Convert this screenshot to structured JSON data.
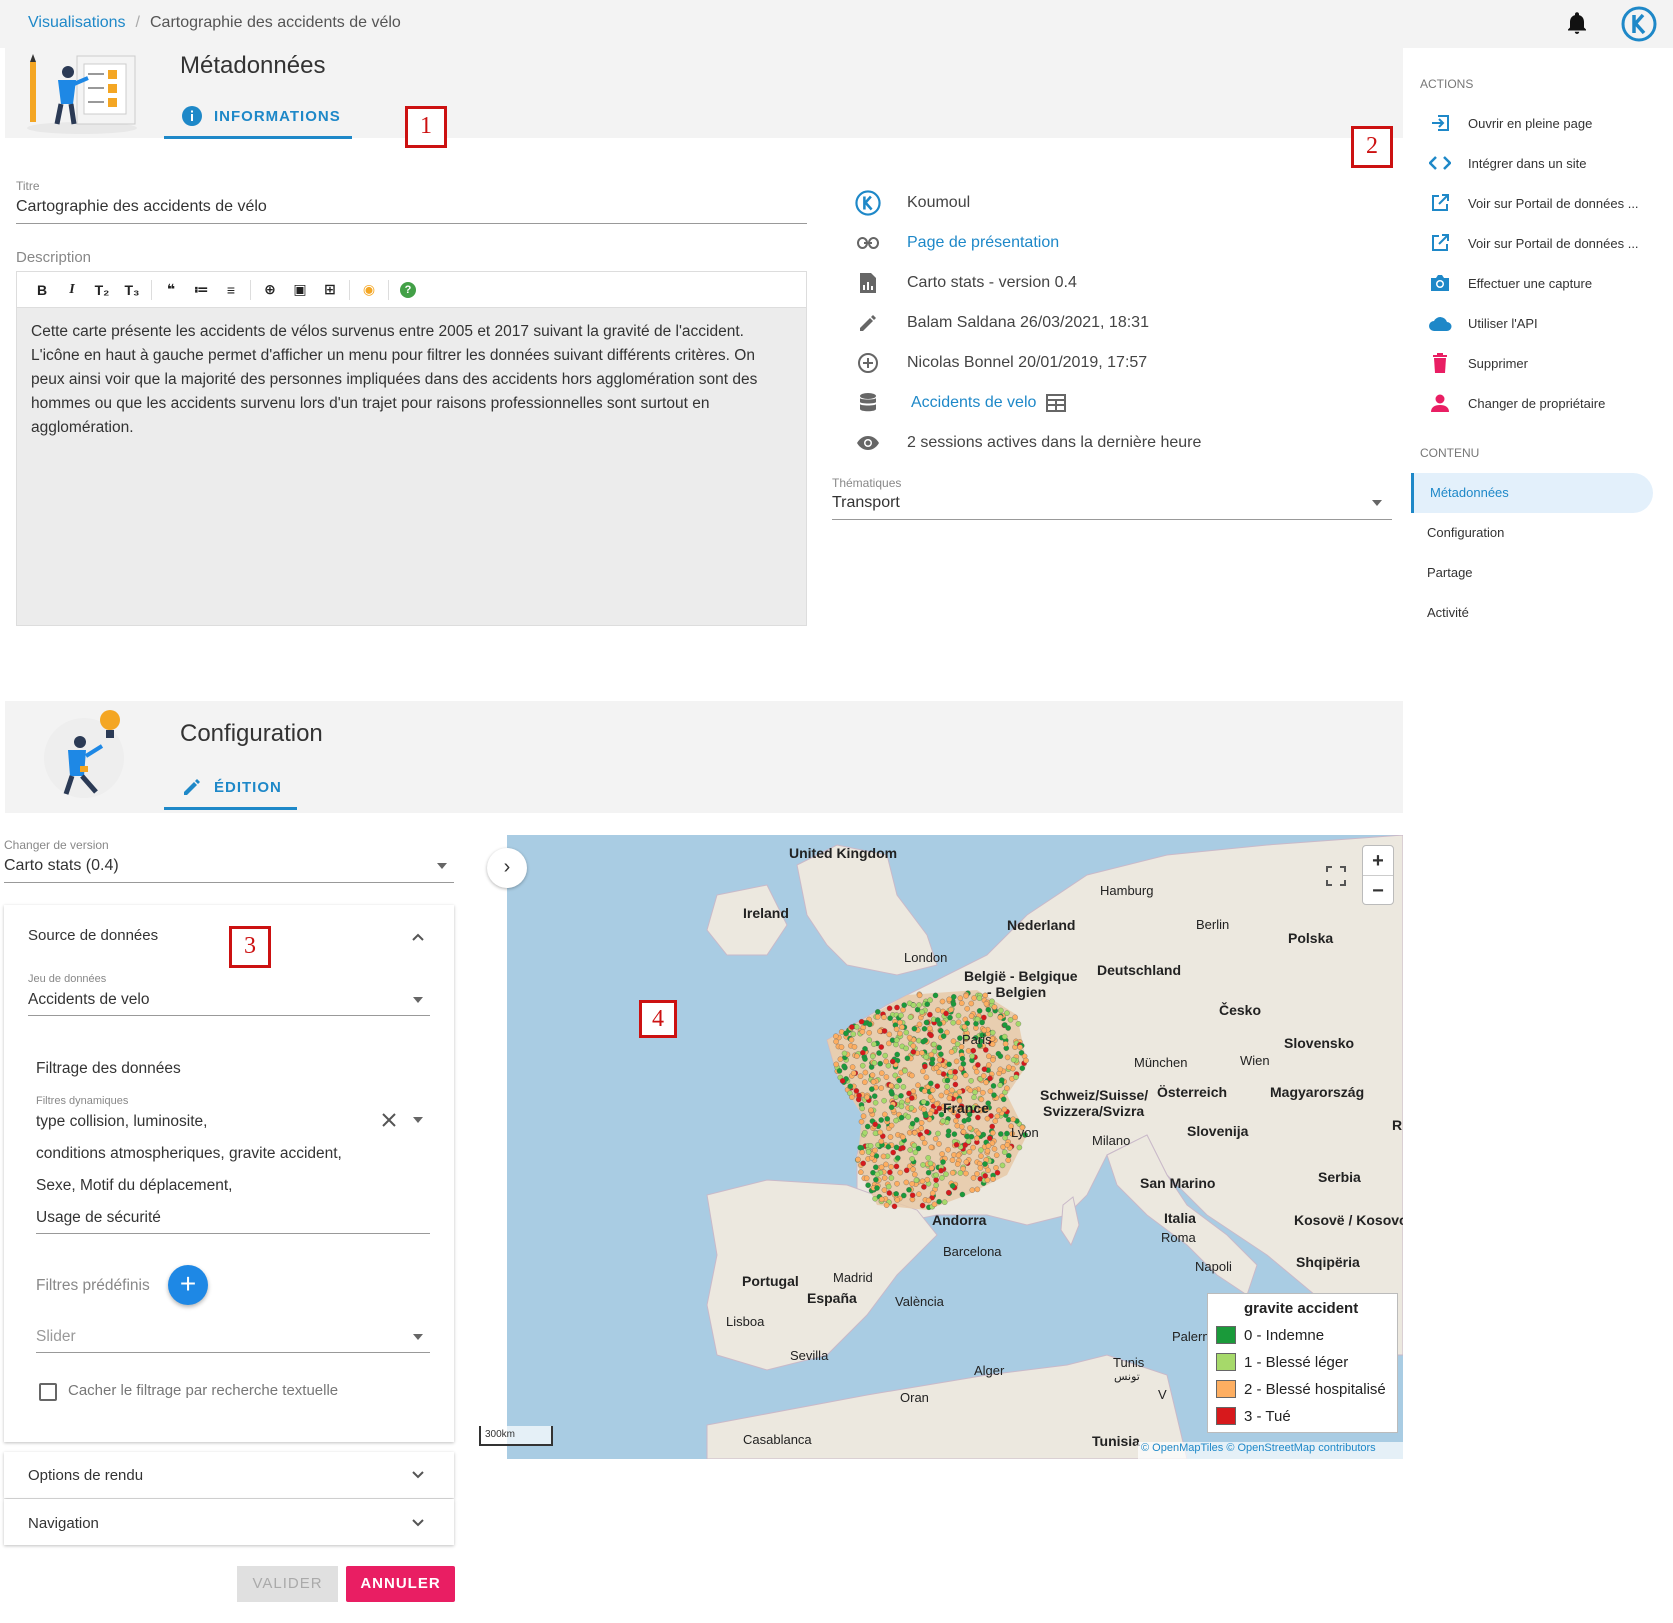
{
  "breadcrumb": {
    "root": "Visualisations",
    "current": "Cartographie des accidents de vélo"
  },
  "annotations": [
    "1",
    "2",
    "3",
    "4"
  ],
  "metadata": {
    "title": "Métadonnées",
    "tab_label": "INFORMATIONS",
    "title_field_label": "Titre",
    "title_field_value": "Cartographie des accidents de vélo",
    "description_label": "Description",
    "toolbar": [
      "B",
      "I",
      "T₂",
      "T₃",
      "❝",
      "≔",
      "≡",
      "⊕",
      "▣",
      "⊞",
      "◉",
      "?"
    ],
    "description_lines": [
      "Cette carte présente les accidents de vélos survenus entre 2005 et 2017 suivant la gravité de l'accident.",
      "L'icône en haut à gauche permet d'afficher un menu pour filtrer les données suivant différents critères. On",
      "peux ainsi voir que la majorité des personnes impliquées dans des accidents hors agglomération sont des",
      "hommes ou que les accidents survenu lors d'un trajet pour raisons professionnelles sont surtout en",
      "agglomération."
    ],
    "info": {
      "owner": "Koumoul",
      "presentation_link": "Page de présentation",
      "version": "Carto stats - version 0.4",
      "updated": "Balam Saldana 26/03/2021, 18:31",
      "created": "Nicolas Bonnel 20/01/2019, 17:57",
      "dataset": "Accidents de velo",
      "sessions": "2 sessions actives dans la dernière heure"
    },
    "thematiques_label": "Thématiques",
    "thematiques_value": "Transport"
  },
  "sidebar": {
    "actions_heading": "ACTIONS",
    "actions": [
      {
        "label": "Ouvrir en pleine page",
        "icon": "fullpage-icon"
      },
      {
        "label": "Intégrer dans un site",
        "icon": "code-icon"
      },
      {
        "label": "Voir sur Portail de données ...",
        "icon": "external-link-icon"
      },
      {
        "label": "Voir sur Portail de données ...",
        "icon": "external-link-icon"
      },
      {
        "label": "Effectuer une capture",
        "icon": "camera-icon"
      },
      {
        "label": "Utiliser l'API",
        "icon": "cloud-icon"
      },
      {
        "label": "Supprimer",
        "icon": "trash-icon"
      },
      {
        "label": "Changer de propriétaire",
        "icon": "person-icon"
      }
    ],
    "content_heading": "CONTENU",
    "content": [
      "Métadonnées",
      "Configuration",
      "Partage",
      "Activité"
    ]
  },
  "configuration": {
    "title": "Configuration",
    "tab_label": "ÉDITION",
    "version_label": "Changer de version",
    "version_value": "Carto stats (0.4)",
    "source_panel_title": "Source de données",
    "dataset_label": "Jeu de données",
    "dataset_value": "Accidents de velo",
    "filter_heading": "Filtrage des données",
    "dynamic_filters_label": "Filtres dynamiques",
    "dynamic_filters_lines": [
      "type collision,  luminosite,",
      "conditions atmospheriques,  gravite accident,",
      "Sexe,  Motif du déplacement,",
      "Usage de sécurité"
    ],
    "predefined_filters_label": "Filtres prédéfinis",
    "slider_placeholder": "Slider",
    "hide_text_filter_label": "Cacher le filtrage par recherche textuelle",
    "render_options_title": "Options de rendu",
    "navigation_title": "Navigation",
    "validate_label": "VALIDER",
    "cancel_label": "ANNULER"
  },
  "map": {
    "labels": {
      "uk": "United Kingdom",
      "ireland": "Ireland",
      "hamburg": "Hamburg",
      "nederland": "Nederland",
      "berlin": "Berlin",
      "polska": "Polska",
      "london": "London",
      "belgie": "België - Belgique",
      "belgien": "- Belgien",
      "deutschland": "Deutschland",
      "cesko": "Česko",
      "paris": "Paris",
      "slovensko": "Slovensko",
      "munchen": "München",
      "wien": "Wien",
      "schweiz": "Schweiz/Suisse/",
      "svizzera": "Svizzera/Svizra",
      "osterreich": "Österreich",
      "magyar": "Magyarország",
      "france": "France",
      "slovenija": "Slovenija",
      "lyon": "Lyon",
      "milano": "Milano",
      "sanmarino": "San Marino",
      "serbia": "Serbia",
      "andorra": "Andorra",
      "italia": "Italia",
      "kosove": "Kosovë / Kosovo",
      "roma": "Roma",
      "barcelona": "Barcelona",
      "napoli": "Napoli",
      "shqiperia": "Shqipëria",
      "portugal": "Portugal",
      "madrid": "Madrid",
      "espana": "España",
      "valencia": "València",
      "lisboa": "Lisboa",
      "sevilla": "Sevilla",
      "alger": "Alger",
      "tunis": "Tunis",
      "tunis_ar": "تونس",
      "palerm": "Palerm",
      "oran": "Oran",
      "casablanca": "Casablanca",
      "tunisia": "Tunisia",
      "r": "R",
      "v": "V"
    },
    "legend_title": "gravite accident",
    "legend": [
      {
        "label": "0 - Indemne",
        "color": "#1a9a3a"
      },
      {
        "label": "1 - Blessé léger",
        "color": "#a6d96a"
      },
      {
        "label": "2 - Blessé hospitalisé",
        "color": "#fdae61"
      },
      {
        "label": "3 - Tué",
        "color": "#d7191c"
      }
    ],
    "scale": "300km",
    "attribution": "© OpenMapTiles © OpenStreetMap contributors",
    "zoom_in": "+",
    "zoom_out": "−",
    "sidebar_toggle": "›"
  }
}
